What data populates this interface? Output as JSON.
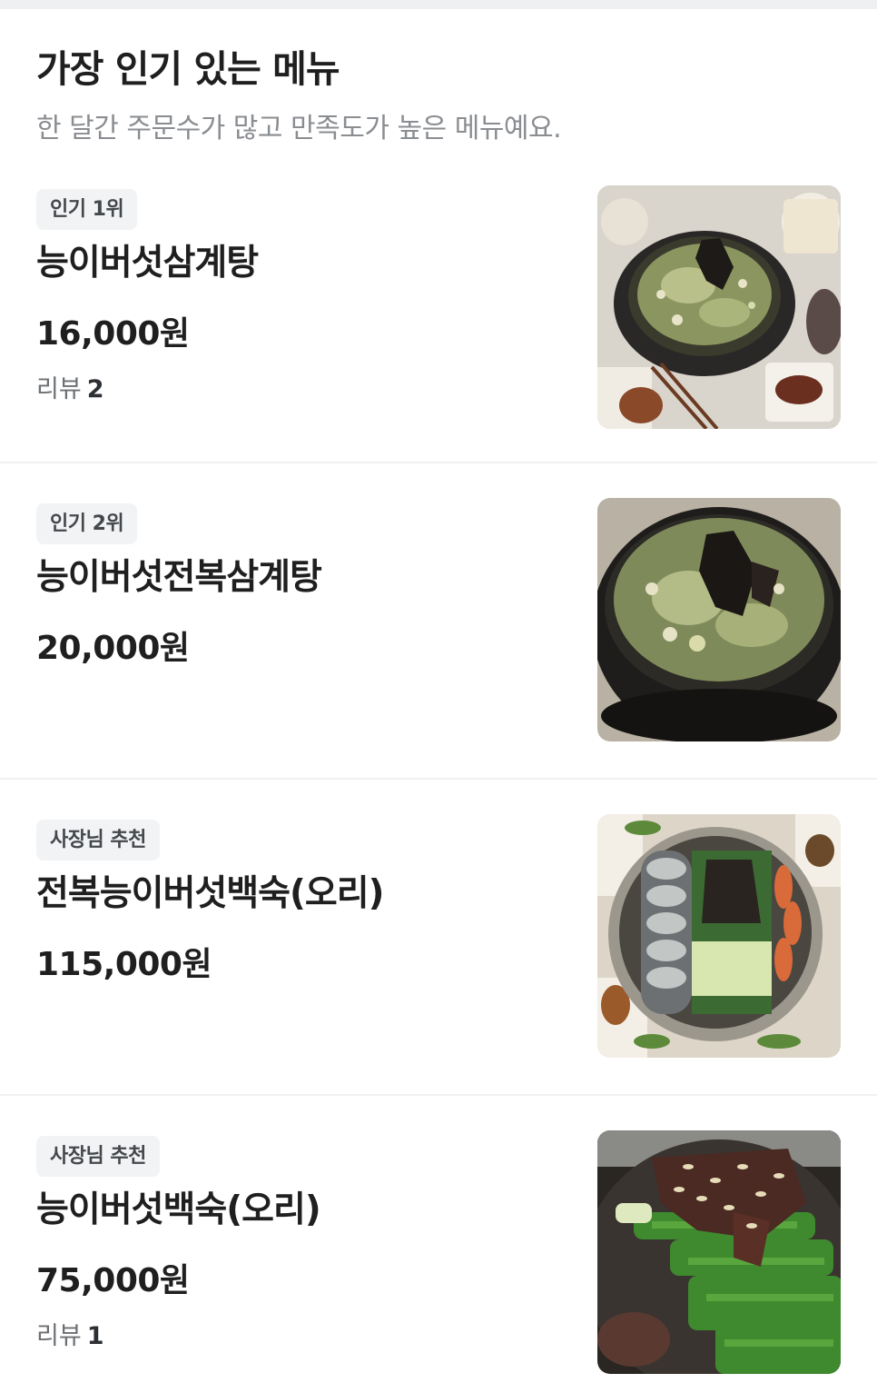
{
  "section": {
    "title": "가장 인기 있는 메뉴",
    "subtitle": "한 달간 주문수가 많고 만족도가 높은 메뉴예요."
  },
  "menu_items": [
    {
      "badge": "인기 1위",
      "name": "능이버섯삼계탕",
      "price": "16,000원",
      "review_label": "리뷰",
      "review_count": "2",
      "image_icon": "samgyetang-photo"
    },
    {
      "badge": "인기 2위",
      "name": "능이버섯전복삼계탕",
      "price": "20,000원",
      "image_icon": "abalone-samgyetang-photo"
    },
    {
      "badge": "사장님 추천",
      "name": "전복능이버섯백숙(오리)",
      "price": "115,000원",
      "image_icon": "abalone-duck-baeksuk-photo"
    },
    {
      "badge": "사장님 추천",
      "name": "능이버섯백숙(오리)",
      "price": "75,000원",
      "review_label": "리뷰",
      "review_count": "1",
      "image_icon": "duck-baeksuk-photo"
    }
  ],
  "colors": {
    "title": "#1f1f1f",
    "subtitle": "#8a8d91",
    "badge_bg": "#f2f3f5",
    "divider": "#f0f1f3"
  }
}
